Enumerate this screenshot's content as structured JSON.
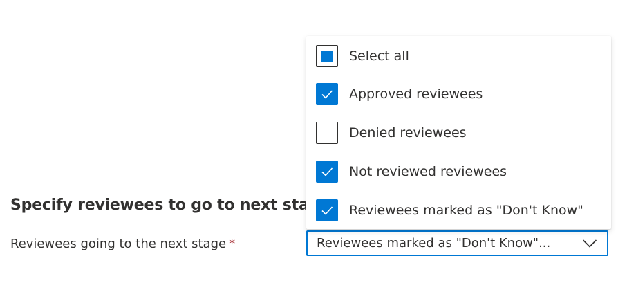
{
  "section": {
    "heading": "Specify reviewees to go to next stage"
  },
  "field": {
    "label": "Reviewees going to the next stage",
    "required_marker": "*",
    "selected_value": "Reviewees marked as \"Don't Know\"..."
  },
  "options": [
    {
      "label": "Select all",
      "state": "indeterminate"
    },
    {
      "label": "Approved reviewees",
      "state": "checked"
    },
    {
      "label": "Denied reviewees",
      "state": "unchecked"
    },
    {
      "label": "Not reviewed reviewees",
      "state": "checked"
    },
    {
      "label": "Reviewees marked as \"Don't Know\"",
      "state": "checked"
    }
  ],
  "colors": {
    "accent": "#0078d4",
    "required": "#a4262c",
    "text": "#323130"
  }
}
